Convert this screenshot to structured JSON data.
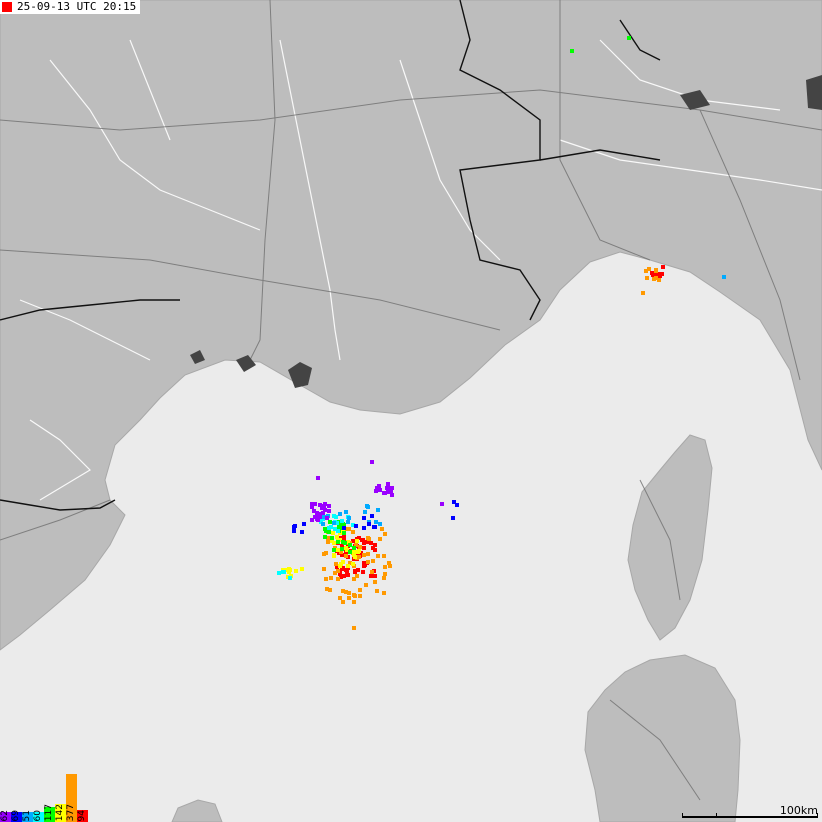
{
  "timestamp": {
    "text": "25-09-13 UTC 20:15",
    "marker_color": "#ff0000"
  },
  "map": {
    "land_color": "#bdbdbd",
    "sea_color": "#ebebeb",
    "border_color": "#111111",
    "river_color": "#ffffff",
    "road_color": "#6f6f6f",
    "city_color": "#444444"
  },
  "legend": {
    "items": [
      {
        "label": "62",
        "color": "#9900ff",
        "count": 62
      },
      {
        "label": "69",
        "color": "#0000ff",
        "count": 69
      },
      {
        "label": "51",
        "color": "#00aaff",
        "count": 51
      },
      {
        "label": "60",
        "color": "#00ffff",
        "count": 60
      },
      {
        "label": "117",
        "color": "#00ff00",
        "count": 117
      },
      {
        "label": "142",
        "color": "#ffff00",
        "count": 142
      },
      {
        "label": "377",
        "color": "#ff9900",
        "count": 377
      },
      {
        "label": "94",
        "color": "#ff0000",
        "count": 94
      }
    ],
    "max": 377
  },
  "scale_bar": {
    "label": "100km"
  }
}
